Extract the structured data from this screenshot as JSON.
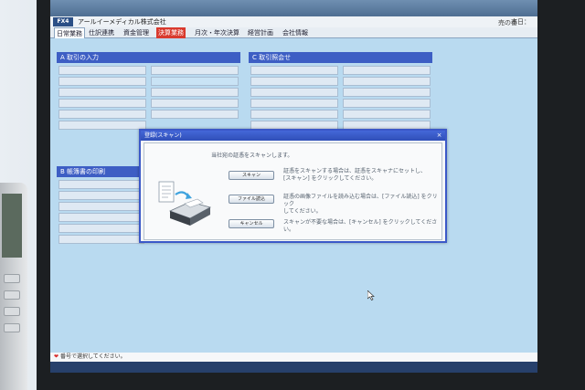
{
  "app": {
    "brand": "FX4",
    "company": "アールイーメディカル株式会社",
    "date_label": "本日：",
    "month_tag": "売の番"
  },
  "tabs": [
    {
      "label": "日常業務",
      "active": true
    },
    {
      "label": "仕訳連携"
    },
    {
      "label": "資金管理"
    },
    {
      "label": "決算業務",
      "highlight": true
    },
    {
      "label": "月次・年次決算"
    },
    {
      "label": "経営計画"
    },
    {
      "label": "会社情報"
    }
  ],
  "panels": {
    "a": {
      "title": "A 取引の入力"
    },
    "b": {
      "title": "B 帳簿書の印刷"
    },
    "c": {
      "title": "C 取引照会せ"
    }
  },
  "dialog": {
    "title": "登録(スキャン)",
    "heading": "当社宛の証憑をスキャンします。",
    "options": [
      {
        "button": "スキャン",
        "desc_1": "証憑をスキャンする場合は、証憑をスキャナにセットし、",
        "desc_2": "[スキャン] をクリックしてください。"
      },
      {
        "button": "ファイル読込",
        "desc_1": "証憑の画像ファイルを読み込む場合は、[ファイル読込] をクリック",
        "desc_2": "してください。"
      },
      {
        "button": "キャンセル",
        "desc_1": "スキャンが不要な場合は、[キャンセル] をクリックしてください。",
        "desc_2": ""
      }
    ],
    "close_glyph": "×"
  },
  "status": {
    "heart": "❤",
    "text": "番号で選択してください。"
  },
  "colors": {
    "screen_bg": "#b9daf0",
    "panel_head": "#3d5ec4",
    "dialog_border": "#3b58c8",
    "hot_tab": "#d93a2e"
  }
}
